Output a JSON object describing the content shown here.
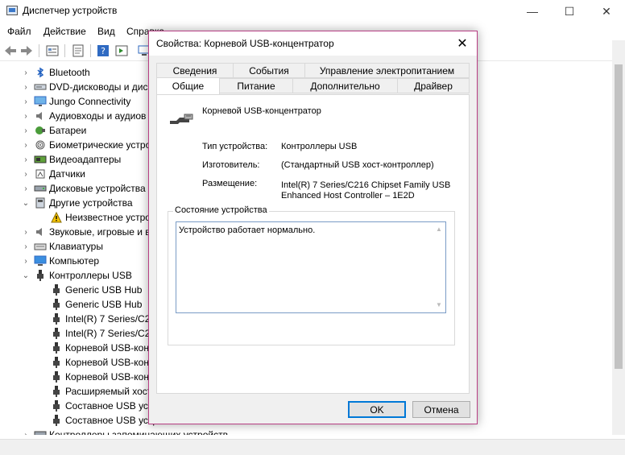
{
  "window": {
    "title": "Диспетчер устройств",
    "min_glyph": "—",
    "max_glyph": "☐",
    "close_glyph": "✕"
  },
  "menu": [
    "Файл",
    "Действие",
    "Вид",
    "Справка"
  ],
  "tree": {
    "items": [
      {
        "label": "Bluetooth",
        "chevron": "›",
        "icon": "bluetooth-icon"
      },
      {
        "label": "DVD-дисководы и дис",
        "chevron": "›",
        "icon": "dvd-drive-icon"
      },
      {
        "label": "Jungo Connectivity",
        "chevron": "›",
        "icon": "monitor-icon"
      },
      {
        "label": "Аудиовходы и аудиов",
        "chevron": "›",
        "icon": "speaker-icon"
      },
      {
        "label": "Батареи",
        "chevron": "›",
        "icon": "battery-icon"
      },
      {
        "label": "Биометрические устро",
        "chevron": "›",
        "icon": "fingerprint-icon"
      },
      {
        "label": "Видеоадаптеры",
        "chevron": "›",
        "icon": "display-adapter-icon"
      },
      {
        "label": "Датчики",
        "chevron": "›",
        "icon": "sensor-icon"
      },
      {
        "label": "Дисковые устройства",
        "chevron": "›",
        "icon": "disk-drive-icon"
      },
      {
        "label": "Другие устройства",
        "chevron": "⌄",
        "icon": "other-devices-icon"
      },
      {
        "label": "Неизвестное устро",
        "chevron": "",
        "icon": "warning-icon"
      },
      {
        "label": "Звуковые, игровые и в",
        "chevron": "›",
        "icon": "speaker-icon"
      },
      {
        "label": "Клавиатуры",
        "chevron": "›",
        "icon": "keyboard-icon"
      },
      {
        "label": "Компьютер",
        "chevron": "›",
        "icon": "computer-icon"
      },
      {
        "label": "Контроллеры USB",
        "chevron": "⌄",
        "icon": "usb-icon"
      },
      {
        "label": "Generic USB Hub",
        "chevron": "",
        "icon": "usb-icon"
      },
      {
        "label": "Generic USB Hub",
        "chevron": "",
        "icon": "usb-icon"
      },
      {
        "label": "Intel(R) 7 Series/C21",
        "chevron": "",
        "icon": "usb-icon"
      },
      {
        "label": "Intel(R) 7 Series/C21",
        "chevron": "",
        "icon": "usb-icon"
      },
      {
        "label": "Корневой USB-конц",
        "chevron": "",
        "icon": "usb-icon"
      },
      {
        "label": "Корневой USB-конц",
        "chevron": "",
        "icon": "usb-icon"
      },
      {
        "label": "Корневой USB-конц",
        "chevron": "",
        "icon": "usb-icon"
      },
      {
        "label": "Расширяемый хост",
        "chevron": "",
        "icon": "usb-icon"
      },
      {
        "label": "Составное USB устр",
        "chevron": "",
        "icon": "usb-icon"
      },
      {
        "label": "Составное USB устр",
        "chevron": "",
        "icon": "usb-icon"
      },
      {
        "label": "Контроллеры запоминающих устройств",
        "chevron": "›",
        "icon": "storage-controller-icon"
      }
    ]
  },
  "dialog": {
    "title": "Свойства: Корневой USB-концентратор",
    "close_glyph": "✕",
    "tabs_back": [
      "Сведения",
      "События",
      "Управление электропитанием"
    ],
    "tabs_front": [
      "Общие",
      "Питание",
      "Дополнительно",
      "Драйвер"
    ],
    "device_name": "Корневой USB-концентратор",
    "props": {
      "type_label": "Тип устройства:",
      "type_value": "Контроллеры USB",
      "maker_label": "Изготовитель:",
      "maker_value": "(Стандартный USB хост-контроллер)",
      "location_label": "Размещение:",
      "location_value_1": "Intel(R) 7 Series/C216 Chipset Family USB",
      "location_value_2": "Enhanced Host Controller – 1E2D"
    },
    "status_group": "Состояние устройства",
    "status_text": "Устройство работает нормально.",
    "ok_label": "OK",
    "cancel_label": "Отмена"
  }
}
